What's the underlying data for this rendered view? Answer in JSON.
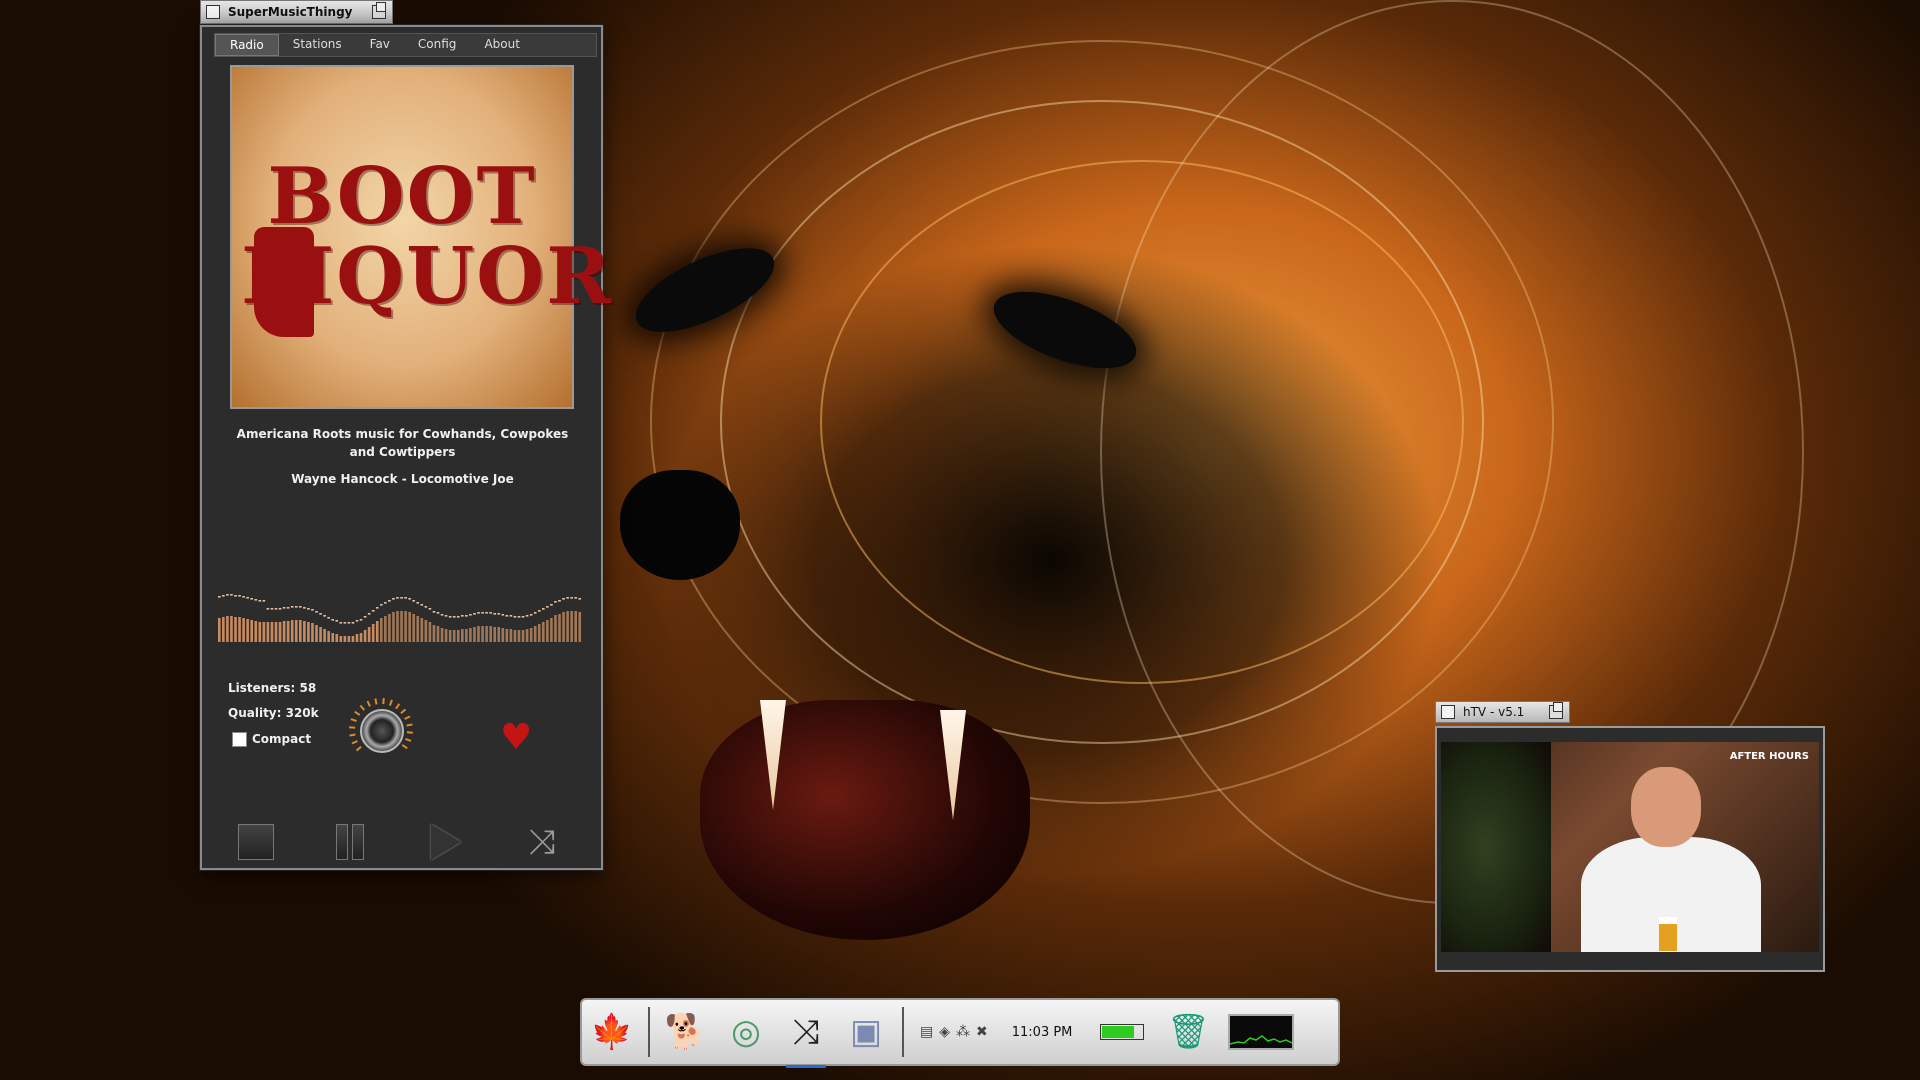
{
  "music_window": {
    "title": "SuperMusicThingy",
    "tabs": [
      "Radio",
      "Stations",
      "Fav",
      "Config",
      "About"
    ],
    "active_tab": "Radio",
    "album_art": {
      "line1": "BOOT",
      "line2": "LIQUOR"
    },
    "station_description": "Americana Roots music for Cowhands, Cowpokes and Cowtippers",
    "now_playing": "Wayne Hancock - Locomotive Joe",
    "listeners_label": "Listeners: 58",
    "quality_label": "Quality: 320k",
    "compact_label": "Compact",
    "compact_checked": false,
    "controls": [
      "stop",
      "pause",
      "play",
      "shuffle"
    ]
  },
  "tv_window": {
    "title": "hTV - v5.1",
    "channel_logo": "AFTER HOURS"
  },
  "dock": {
    "clock": "11:03 PM",
    "battery_level": 0.8,
    "battery_color": "#2ecc20",
    "items": [
      "maple-leaf-icon",
      "gimp-icon",
      "disc-icon",
      "shuffle-icon",
      "window-icon",
      "trash-icon"
    ]
  },
  "colors": {
    "accent_red": "#c41414",
    "album_text": "#9a1010"
  }
}
